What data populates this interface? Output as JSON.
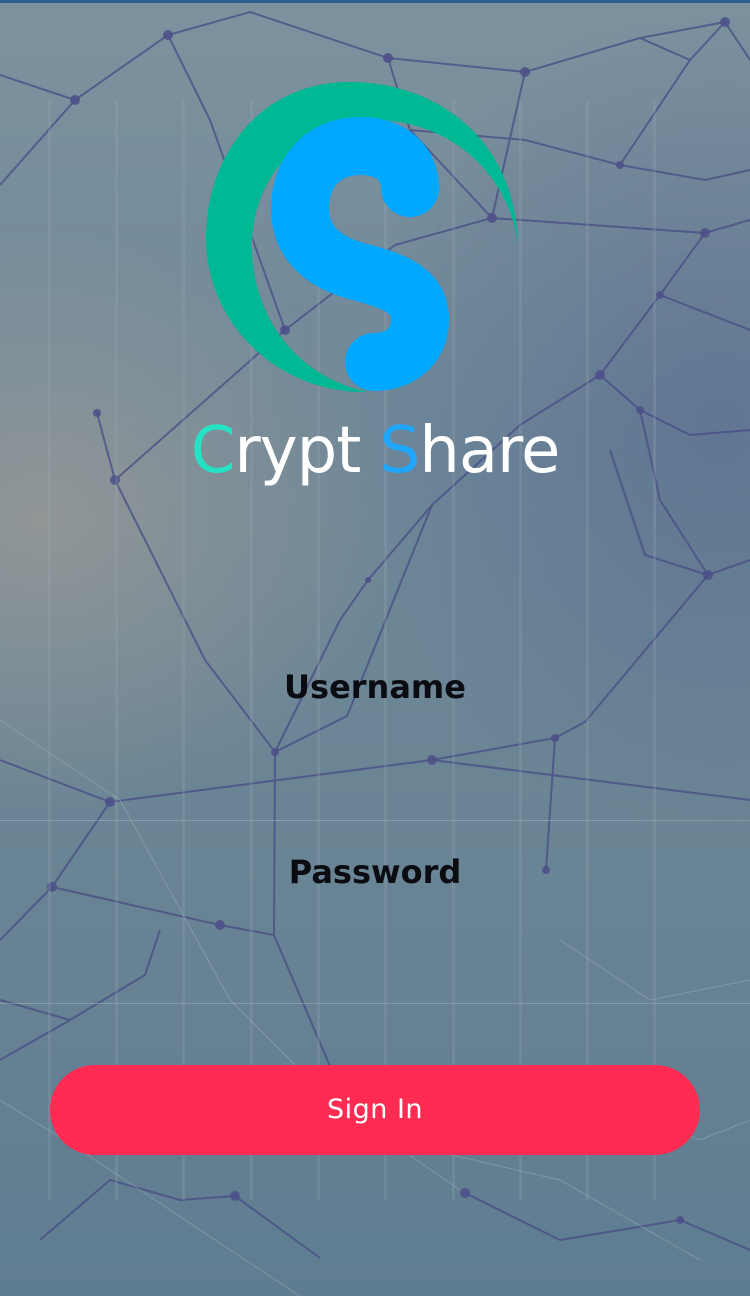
{
  "app": {
    "logo_icon": "crypt-share-logo-icon",
    "brand_first_initial": "C",
    "brand_first_rest": "rypt ",
    "brand_second_initial": "S",
    "brand_second_rest": "hare"
  },
  "form": {
    "username_label": "Username",
    "password_label": "Password",
    "signin_label": "Sign In"
  },
  "colors": {
    "accent_teal": "#00b894",
    "accent_blue": "#00a8ff",
    "button": "#ff2b53",
    "background": "#6f8595"
  }
}
